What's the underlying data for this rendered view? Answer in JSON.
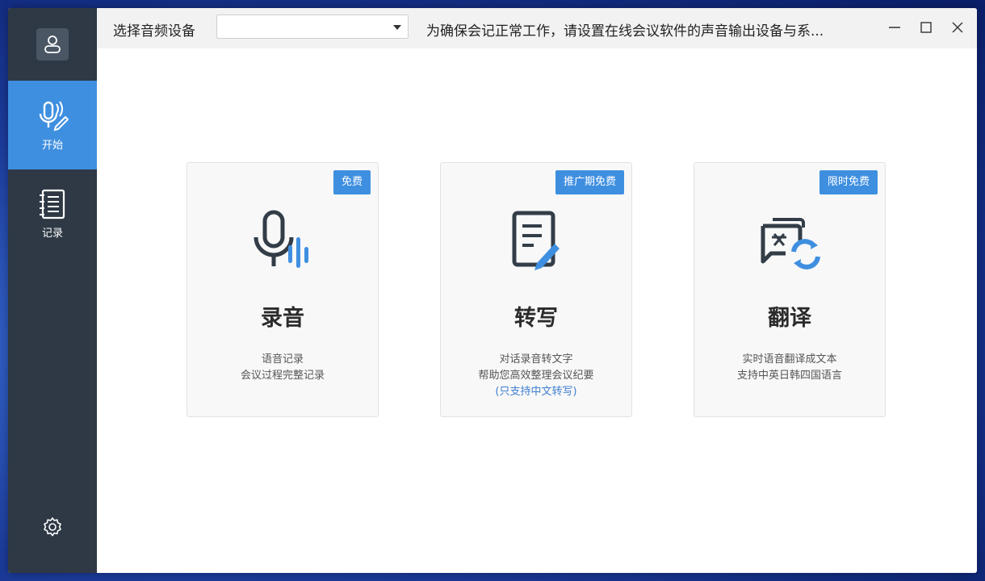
{
  "sidebar": {
    "items": [
      {
        "label": "开始",
        "icon": "mic-pen-icon",
        "active": true
      },
      {
        "label": "记录",
        "icon": "notebook-icon",
        "active": false
      }
    ]
  },
  "titlebar": {
    "device_label": "选择音频设备",
    "device_value": "",
    "hint": "为确保会记正常工作，请设置在线会议软件的声音输出设备与系..."
  },
  "cards": [
    {
      "badge": "免费",
      "title": "录音",
      "desc1": "语音记录",
      "desc2": "会议过程完整记录",
      "note": ""
    },
    {
      "badge": "推广期免费",
      "title": "转写",
      "desc1": "对话录音转文字",
      "desc2": "帮助您高效整理会议纪要",
      "note": "(只支持中文转写)"
    },
    {
      "badge": "限时免费",
      "title": "翻译",
      "desc1": "实时语音翻译成文本",
      "desc2": "支持中英日韩四国语言",
      "note": ""
    }
  ],
  "colors": {
    "accent": "#3f8fe0",
    "sidebar": "#2e3945",
    "dark_icon": "#333d48"
  }
}
